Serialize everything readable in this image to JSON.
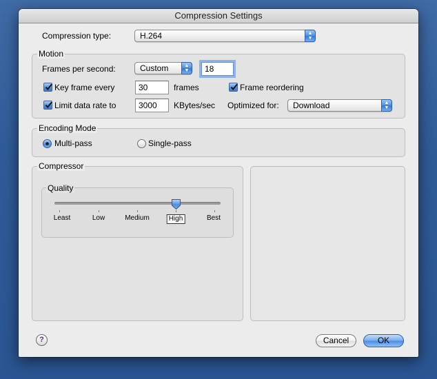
{
  "window": {
    "title": "Compression Settings"
  },
  "compression": {
    "label": "Compression type:",
    "value": "H.264"
  },
  "motion": {
    "title": "Motion",
    "fps_label": "Frames per second:",
    "fps_popup": "Custom",
    "fps_value": "18",
    "keyframe_label": "Key frame every",
    "keyframe_checked": true,
    "keyframe_value": "30",
    "keyframe_unit": "frames",
    "reorder_label": "Frame reordering",
    "reorder_checked": true,
    "limit_label": "Limit data rate to",
    "limit_checked": true,
    "limit_value": "3000",
    "limit_unit": "KBytes/sec",
    "optimized_label": "Optimized for:",
    "optimized_value": "Download"
  },
  "encoding": {
    "title": "Encoding Mode",
    "options": [
      "Multi-pass",
      "Single-pass"
    ],
    "selected": "Multi-pass"
  },
  "compressor": {
    "title": "Compressor",
    "quality": {
      "title": "Quality",
      "levels": [
        "Least",
        "Low",
        "Medium",
        "High",
        "Best"
      ],
      "selected": "High",
      "selected_index": 3
    }
  },
  "buttons": {
    "help": "?",
    "cancel": "Cancel",
    "ok": "OK"
  },
  "colors": {
    "desktop": "#2f5c98",
    "accent": "#4f8fdc",
    "help_glyph": "#6a2c8e"
  },
  "icons": {
    "popup": "up-down-arrows-icon",
    "check": "checkmark-icon",
    "help": "question-mark-icon",
    "thumb": "slider-thumb-icon"
  }
}
